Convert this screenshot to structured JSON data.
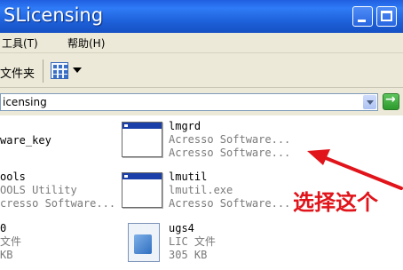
{
  "window": {
    "title": "SLicensing"
  },
  "menu": {
    "tools": "工具(T)",
    "help": "帮助(H)"
  },
  "toolbar": {
    "folders_label": "文件夹",
    "views_icon": "views-icon"
  },
  "address": {
    "path": "icensing"
  },
  "files": [
    {
      "name": "ware_key",
      "line2": "",
      "line3": "",
      "icon": "none"
    },
    {
      "name": "lmgrd",
      "line2": "Acresso Software...",
      "line3": "Acresso Software...",
      "icon": "exe-icon"
    },
    {
      "name": "ools",
      "line2": "OOLS Utility",
      "line3": "cresso Software...",
      "icon": "none"
    },
    {
      "name": "lmutil",
      "line2": "lmutil.exe",
      "line3": "Acresso Software...",
      "icon": "exe-icon"
    },
    {
      "name": "0",
      "line2": "文件",
      "line3": "KB",
      "icon": "none"
    },
    {
      "name": "ugs4",
      "line2": "LIC 文件",
      "line3": "305 KB",
      "icon": "document-icon"
    }
  ],
  "annotation": {
    "text": "选择这个",
    "color": "#e0141a"
  },
  "colors": {
    "titlebar": "#2f7bf7",
    "chrome": "#ece9d8"
  }
}
